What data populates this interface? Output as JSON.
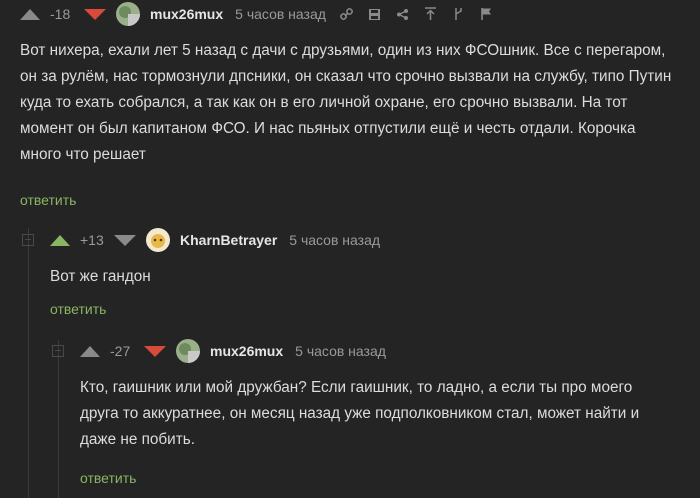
{
  "comments": [
    {
      "rating": "-18",
      "author": "mux26mux",
      "time": "5 часов назад",
      "text": "Вот нихера, ехали лет 5 назад с дачи с друзьями, один из них ФСОшник. Все с перегаром, он за рулём, нас тормознули дпсники, он сказал что срочно вызвали на службу, типо Путин куда то ехать собрался, а так как он в его личной охране, его срочно вызвали. На тот момент он был капитаном ФСО. И нас пьяных отпустили ещё и честь отдали. Корочка много что решает",
      "reply_label": "ответить"
    },
    {
      "rating": "+13",
      "author": "KharnBetrayer",
      "time": "5 часов назад",
      "text": "Вот же гандон",
      "reply_label": "ответить"
    },
    {
      "rating": "-27",
      "author": "mux26mux",
      "time": "5 часов назад",
      "text": "Кто, гаишник или мой дружбан? Если гаишник, то ладно, а если ты про моего друга то аккуратнее, он месяц назад уже подполковником стал, может найти и даже не побить.",
      "reply_label": "ответить"
    }
  ],
  "icons": [
    "link-icon",
    "save-icon",
    "share-icon",
    "go-to-parent-icon",
    "branch-icon",
    "flag-icon"
  ]
}
